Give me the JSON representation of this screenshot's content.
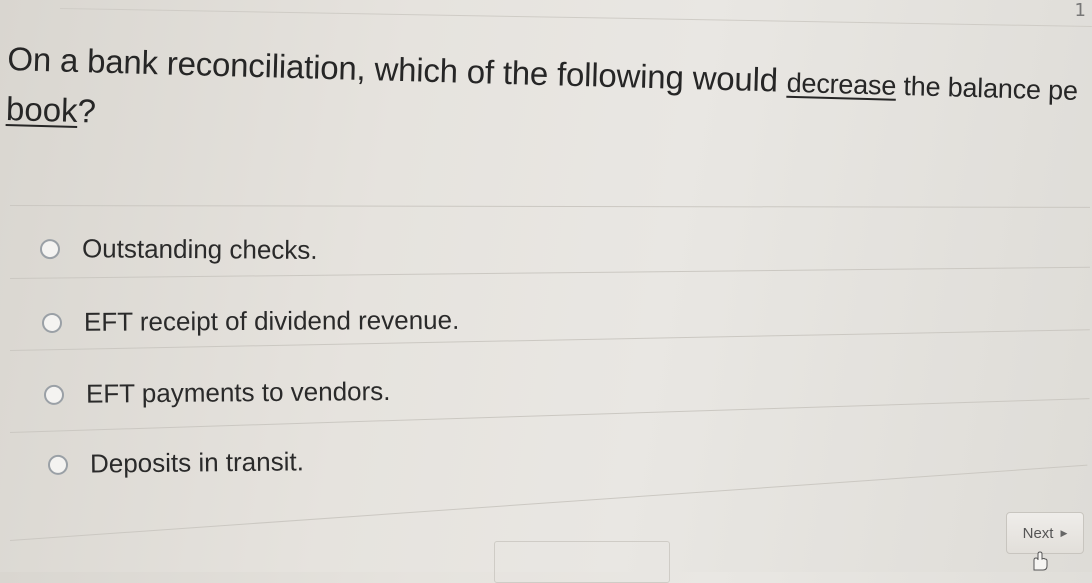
{
  "page": {
    "corner_number": "1"
  },
  "question": {
    "text_part1": "On a bank reconciliation, which of the following would ",
    "emphasis": "decrease",
    "text_part2": " the balance pe",
    "line2_emphasis": "book",
    "line2_end": "?"
  },
  "options": [
    {
      "label": "Outstanding checks."
    },
    {
      "label": "EFT receipt of dividend revenue."
    },
    {
      "label": "EFT payments to vendors."
    },
    {
      "label": "Deposits in transit."
    }
  ],
  "navigation": {
    "next_label": "Next",
    "next_icon": "triangle-right-icon",
    "cursor_icon": "hand-pointer-icon"
  }
}
